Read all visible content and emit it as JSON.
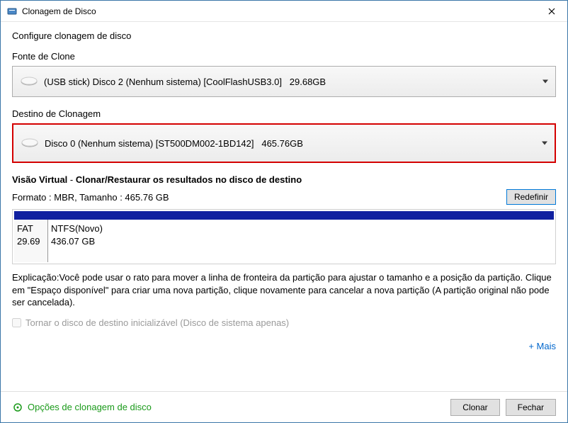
{
  "window": {
    "title": "Clonagem de Disco"
  },
  "subtitle": "Configure clonagem de disco",
  "source": {
    "label": "Fonte de Clone",
    "text": "(USB stick) Disco 2 (Nenhum sistema) [CoolFlashUSB3.0]   29.68GB"
  },
  "dest": {
    "label": "Destino de Clonagem",
    "text": "Disco 0 (Nenhum sistema) [ST500DM002-1BD142]   465.76GB"
  },
  "virtual": {
    "prefix": "Visão Virtual",
    "separator": " - ",
    "suffix": "Clonar/Restaurar os resultados no disco de destino",
    "format": "Formato : MBR,  Tamanho : 465.76 GB",
    "reset_btn": "Redefinir",
    "partitions": [
      {
        "name": "FAT",
        "size": "29.69"
      },
      {
        "name": "NTFS(Novo)",
        "size": "436.07 GB"
      }
    ]
  },
  "explain": "Explicação:Você pode usar o rato para mover a linha de fronteira da partição para ajustar o tamanho e a posição da partição. Clique em \"Espaço disponível\" para criar uma nova partição, clique novamente para cancelar a nova partição (A partição original não pode ser cancelada).",
  "bootable_checkbox": "Tornar o disco de destino inicializável (Disco de sistema apenas)",
  "more_link": "+ Mais",
  "footer": {
    "options_link": "Opções de clonagem de disco",
    "clone_btn": "Clonar",
    "close_btn": "Fechar"
  }
}
